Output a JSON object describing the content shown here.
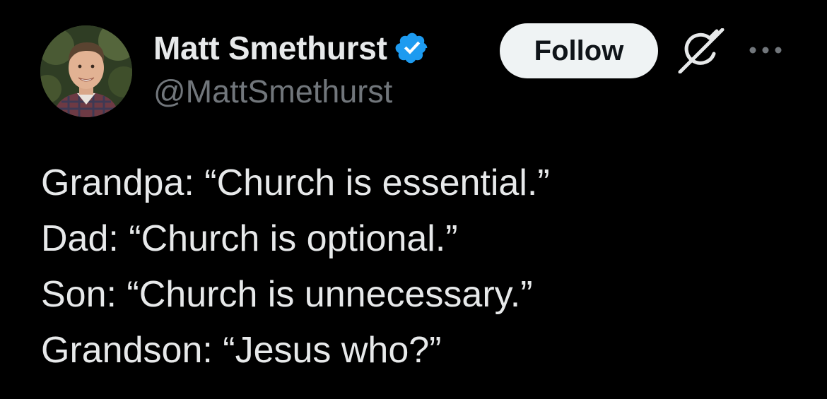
{
  "author": {
    "display_name": "Matt Smethurst",
    "handle": "@MattSmethurst",
    "verified": true,
    "verified_color": "#1d9bf0"
  },
  "actions": {
    "follow_label": "Follow",
    "grok_icon": "grok-icon",
    "more_icon": "more-options-icon"
  },
  "tweet": {
    "lines": [
      "Grandpa: “Church is essential.”",
      "Dad: “Church is optional.”",
      "Son: “Church is unnecessary.”",
      "Grandson: “Jesus who?”"
    ]
  },
  "colors": {
    "background": "#000000",
    "text_primary": "#e7e9ea",
    "text_secondary": "#71767b",
    "button_bg": "#eff3f4",
    "button_text": "#0f1419"
  }
}
